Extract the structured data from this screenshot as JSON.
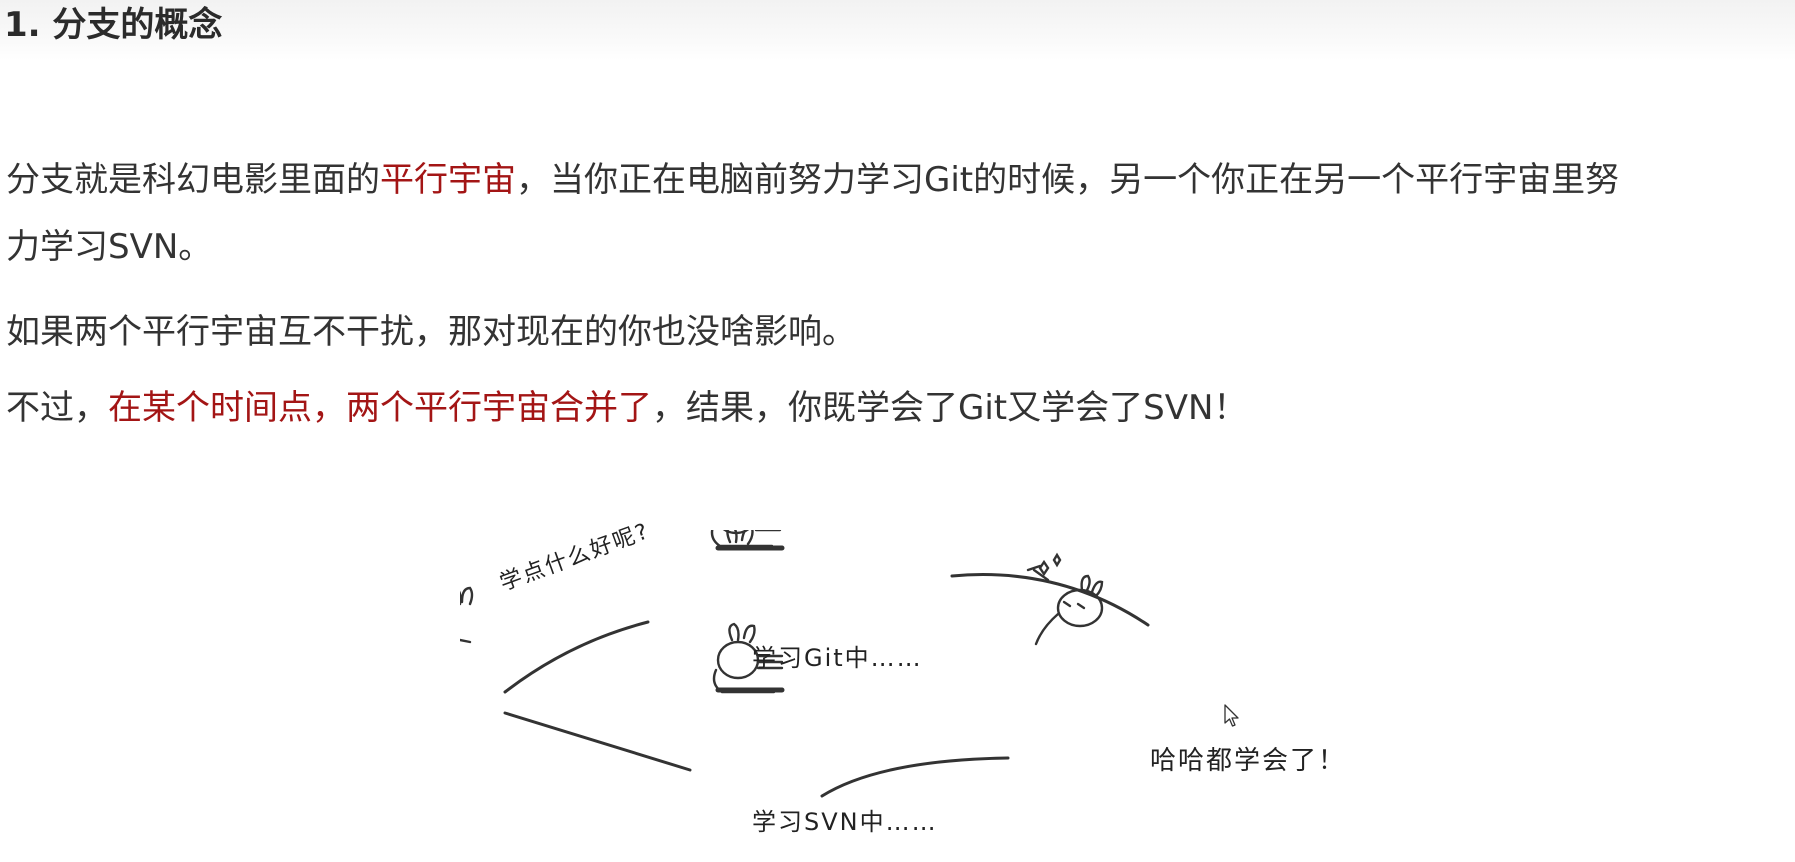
{
  "heading": "1. 分支的概念",
  "paragraph1": {
    "line1_before": "分支就是科幻电影里面的",
    "line1_highlight": "平行宇宙",
    "line1_after": "，当你正在电脑前努力学习Git的时候，另一个你正在另一个平行宇宙里努",
    "line2": "力学习SVN。"
  },
  "paragraph2": "如果两个平行宇宙互不干扰，那对现在的你也没啥影响。",
  "paragraph3": {
    "before": "不过，",
    "highlight": "在某个时间点，两个平行宇宙合并了",
    "after": "，结果，你既学会了Git又学会了SVN！"
  },
  "diagram": {
    "question_label": "学点什么好呢?",
    "git_label": "学习Git中……",
    "svn_label": "学习SVN中……",
    "merged_label": "哈哈都学会了！"
  },
  "colors": {
    "highlight": "#a31515",
    "text": "#333333"
  }
}
